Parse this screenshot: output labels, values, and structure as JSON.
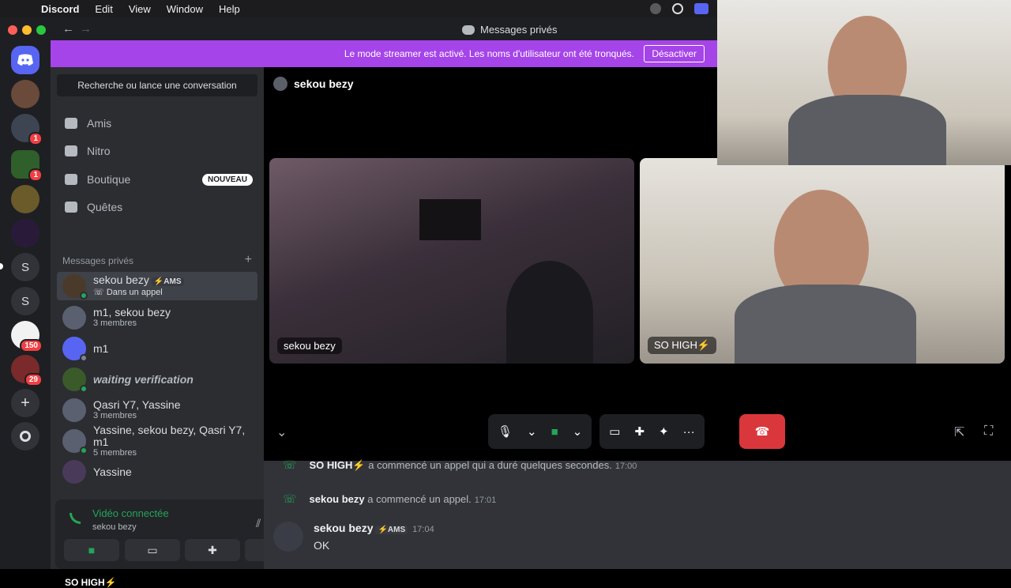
{
  "menubar": {
    "app": "Discord",
    "items": [
      "Edit",
      "View",
      "Window",
      "Help"
    ]
  },
  "window": {
    "title": "Messages privés"
  },
  "banner": {
    "text": "Le mode streamer est activé. Les noms d'utilisateur ont été tronqués.",
    "button": "Désactiver"
  },
  "rail": {
    "servers": [
      {
        "label": "",
        "badge": ""
      },
      {
        "label": "",
        "badge": "1"
      },
      {
        "label": "",
        "badge": "1"
      },
      {
        "label": "",
        "badge": ""
      },
      {
        "label": "",
        "badge": ""
      },
      {
        "label": "S",
        "badge": ""
      },
      {
        "label": "S",
        "badge": ""
      },
      {
        "label": "",
        "badge": "150"
      },
      {
        "label": "",
        "badge": "29"
      }
    ]
  },
  "sidebar": {
    "search": "Recherche ou lance une conversation",
    "nav": [
      {
        "label": "Amis"
      },
      {
        "label": "Nitro"
      },
      {
        "label": "Boutique",
        "badge": "NOUVEAU"
      },
      {
        "label": "Quêtes"
      }
    ],
    "dm_header": "Messages privés",
    "dms": [
      {
        "name": "sekou bezy",
        "tag": "⚡AMS",
        "sub": "Dans un appel"
      },
      {
        "name": "m1, sekou bezy",
        "sub": "3 membres"
      },
      {
        "name": "m1",
        "sub": ""
      },
      {
        "name": "waiting verification",
        "sub": ""
      },
      {
        "name": "Qasri Y7, Yassine",
        "sub": "3 membres"
      },
      {
        "name": "Yassine, sekou bezy, Qasri Y7, m1",
        "sub": "5 membres"
      },
      {
        "name": "Yassine",
        "sub": ""
      }
    ],
    "voice": {
      "status": "Vidéo connectée",
      "channel": "sekou bezy"
    },
    "user": "SO HIGH⚡"
  },
  "call": {
    "header": "sekou bezy",
    "tiles": [
      {
        "label": "sekou bezy"
      },
      {
        "label": "SO HIGH⚡"
      }
    ]
  },
  "chat": {
    "system": [
      {
        "name": "SO HIGH⚡",
        "text": "a commencé un appel qui a duré quelques secondes.",
        "time": "17:00"
      },
      {
        "name": "sekou bezy",
        "text": "a commencé un appel.",
        "time": "17:01"
      }
    ],
    "message": {
      "author": "sekou bezy",
      "tag": "⚡AMS",
      "time": "17:04",
      "text": "OK"
    }
  },
  "colors": {
    "blurple": "#5865f2",
    "streamer": "#a544e8",
    "green": "#23a55a",
    "red": "#da373c"
  }
}
